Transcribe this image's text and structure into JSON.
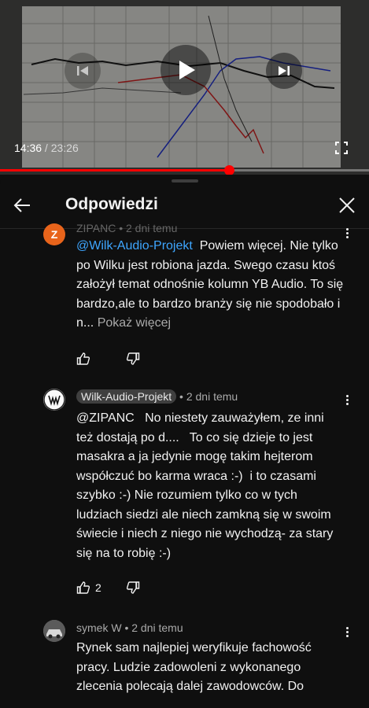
{
  "player": {
    "current_time": "14:36",
    "separator": " / ",
    "duration": "23:26",
    "progress": 0.622,
    "controls": [
      "previous-icon",
      "play-icon",
      "next-icon",
      "fullscreen-icon"
    ]
  },
  "panel": {
    "title": "Odpowiedzi"
  },
  "comments": [
    {
      "author": "ZIPANC",
      "age": "2 dni temu",
      "avatar_letter": "Z",
      "avatar_color": "#e8641b",
      "mention": "@Wilk-Audio-Projekt",
      "text": "  Powiem więcej. Nie tylko po Wilku jest robiona jazda. Swego czasu ktoś założył temat odnośnie kolumn YB Audio. To się bardzo,ale to bardzo branży się nie spodobało i n...",
      "more": "Pokaż więcej",
      "likes": ""
    },
    {
      "author": "Wilk-Audio-Projekt",
      "age": "2 dni temu",
      "text": "@ZIPANC   No niestety zauważyłem, ze inni też dostają po d....   To co się dzieje to jest masakra a ja jedynie mogę takim hejterom współczuć bo karma wraca :-)  i to czasami szybko :-) Nie rozumiem tylko co w tych ludziach siedzi ale niech zamkną się w swoim świecie i niech z niego nie wychodzą- za stary się na to robię :-)",
      "likes": "2"
    },
    {
      "author": "symek W",
      "age": "2 dni temu",
      "text": "Rynek sam najlepiej weryfikuje fachowość pracy. Ludzie zadowoleni z wykonanego zlecenia polecają dalej zawodowców. Do",
      "likes": ""
    }
  ],
  "meta_separator": " • ",
  "colors": {
    "background": "#0f0f0f",
    "text": "#f1f1f1",
    "secondary_text": "#aaaaaa",
    "mention": "#3ea6ff",
    "progress": "#ff0000"
  }
}
